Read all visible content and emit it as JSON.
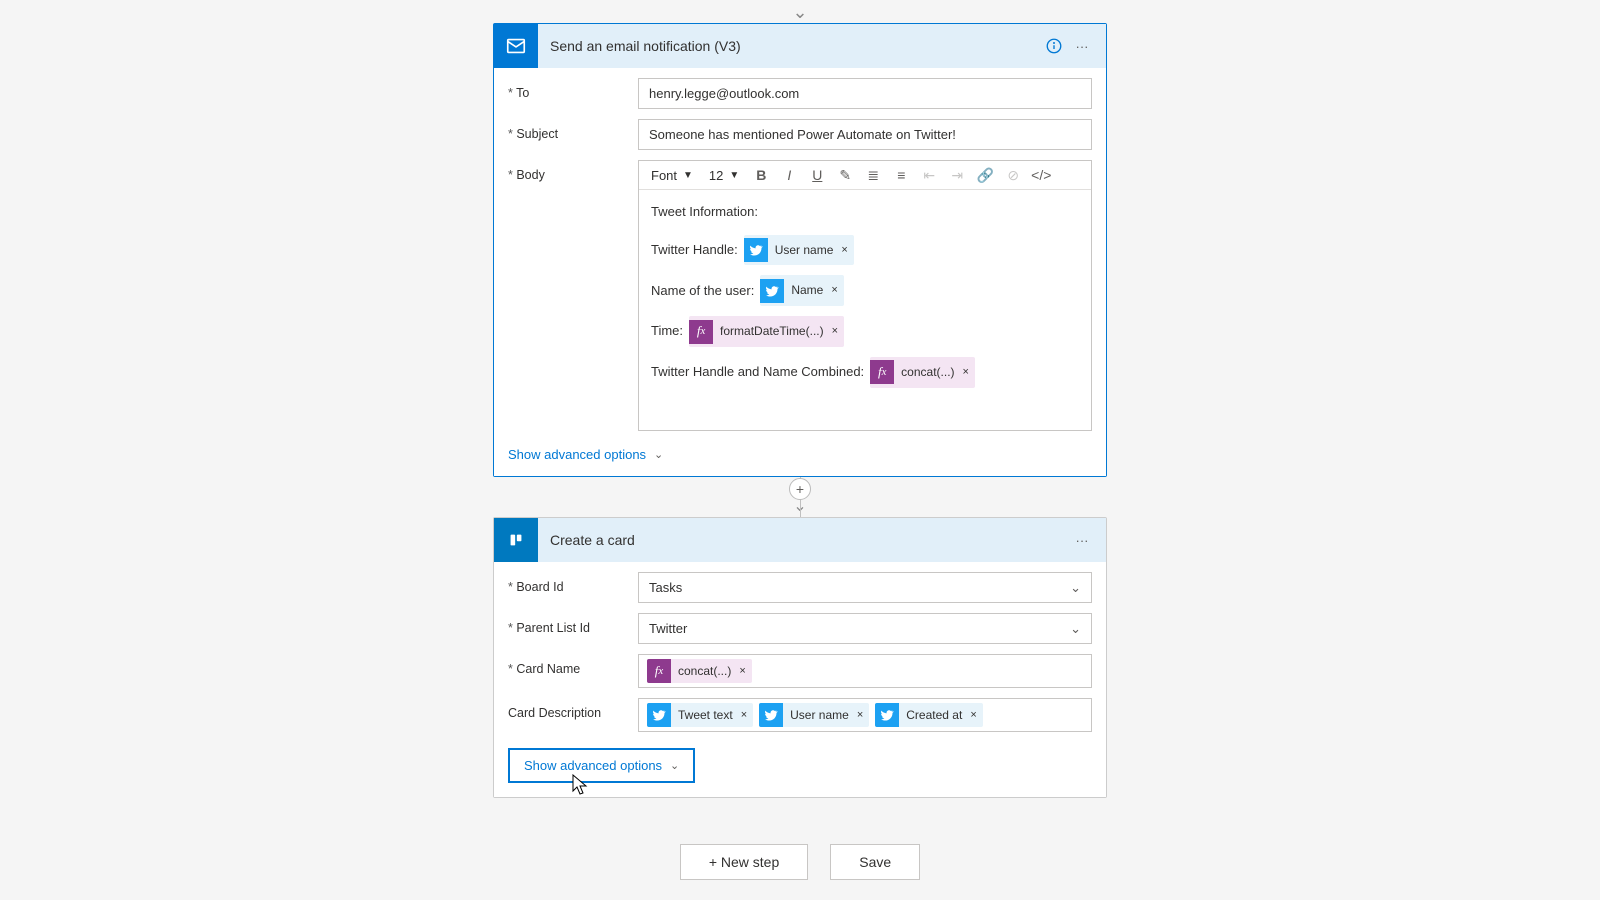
{
  "connector": {
    "arrow_in": true,
    "plus_arrow": true
  },
  "email_card": {
    "title": "Send an email notification (V3)",
    "fields": {
      "to_label": "To",
      "to_value": "henry.legge@outlook.com",
      "subject_label": "Subject",
      "subject_value": "Someone has mentioned Power Automate on Twitter!",
      "body_label": "Body"
    },
    "rte": {
      "font_label": "Font",
      "size_label": "12"
    },
    "body": {
      "line1": "Tweet Information:",
      "line2_prefix": "Twitter Handle:",
      "line3_prefix": "Name of the user:",
      "line4_prefix": "Time:",
      "line5_prefix": "Twitter Handle and Name Combined:",
      "tok_username": "User name",
      "tok_name": "Name",
      "tok_format": "formatDateTime(...)",
      "tok_concat": "concat(...)"
    },
    "adv_label": "Show advanced options"
  },
  "trello_card": {
    "title": "Create a card",
    "fields": {
      "board_label": "Board Id",
      "board_value": "Tasks",
      "parent_label": "Parent List Id",
      "parent_value": "Twitter",
      "cardname_label": "Card Name",
      "carddesc_label": "Card Description",
      "tok_concat": "concat(...)",
      "tok_tweettext": "Tweet text",
      "tok_username": "User name",
      "tok_createdat": "Created at"
    },
    "adv_label": "Show advanced options"
  },
  "footer": {
    "new_step": "+ New step",
    "save": "Save"
  }
}
